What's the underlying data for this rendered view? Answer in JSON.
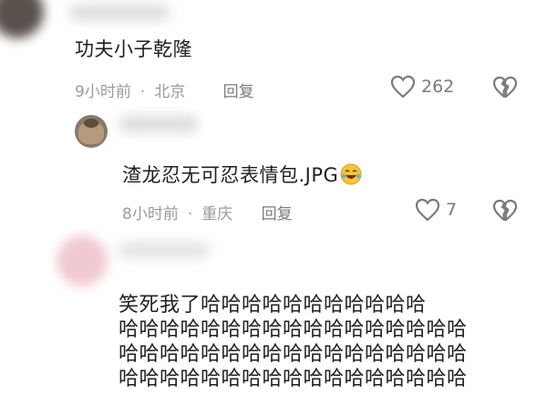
{
  "comment1": {
    "text": "功夫小子乾隆",
    "time": "9小时前",
    "location": "北京",
    "reply_label": "回复",
    "like_count": "262"
  },
  "comment2": {
    "text": "渣龙忍无可忍表情包.JPG",
    "time": "8小时前",
    "location": "重庆",
    "reply_label": "回复",
    "like_count": "7"
  },
  "comment3": {
    "lines": [
      "笑死我了哈哈哈哈哈哈哈哈哈哈哈",
      "哈哈哈哈哈哈哈哈哈哈哈哈哈哈哈哈哈",
      "哈哈哈哈哈哈哈哈哈哈哈哈哈哈哈哈哈",
      "哈哈哈哈哈哈哈哈哈哈哈哈哈哈哈哈哈"
    ]
  },
  "separator_dot": "·",
  "icons": {
    "like": "heart-outline-icon",
    "dislike": "broken-heart-icon",
    "emoji": "laughing-emoji-icon"
  },
  "colors": {
    "meta_gray": "#9a9a9a",
    "icon_gray": "#7a7a7a",
    "emoji_yellow": "#f7c43b"
  }
}
